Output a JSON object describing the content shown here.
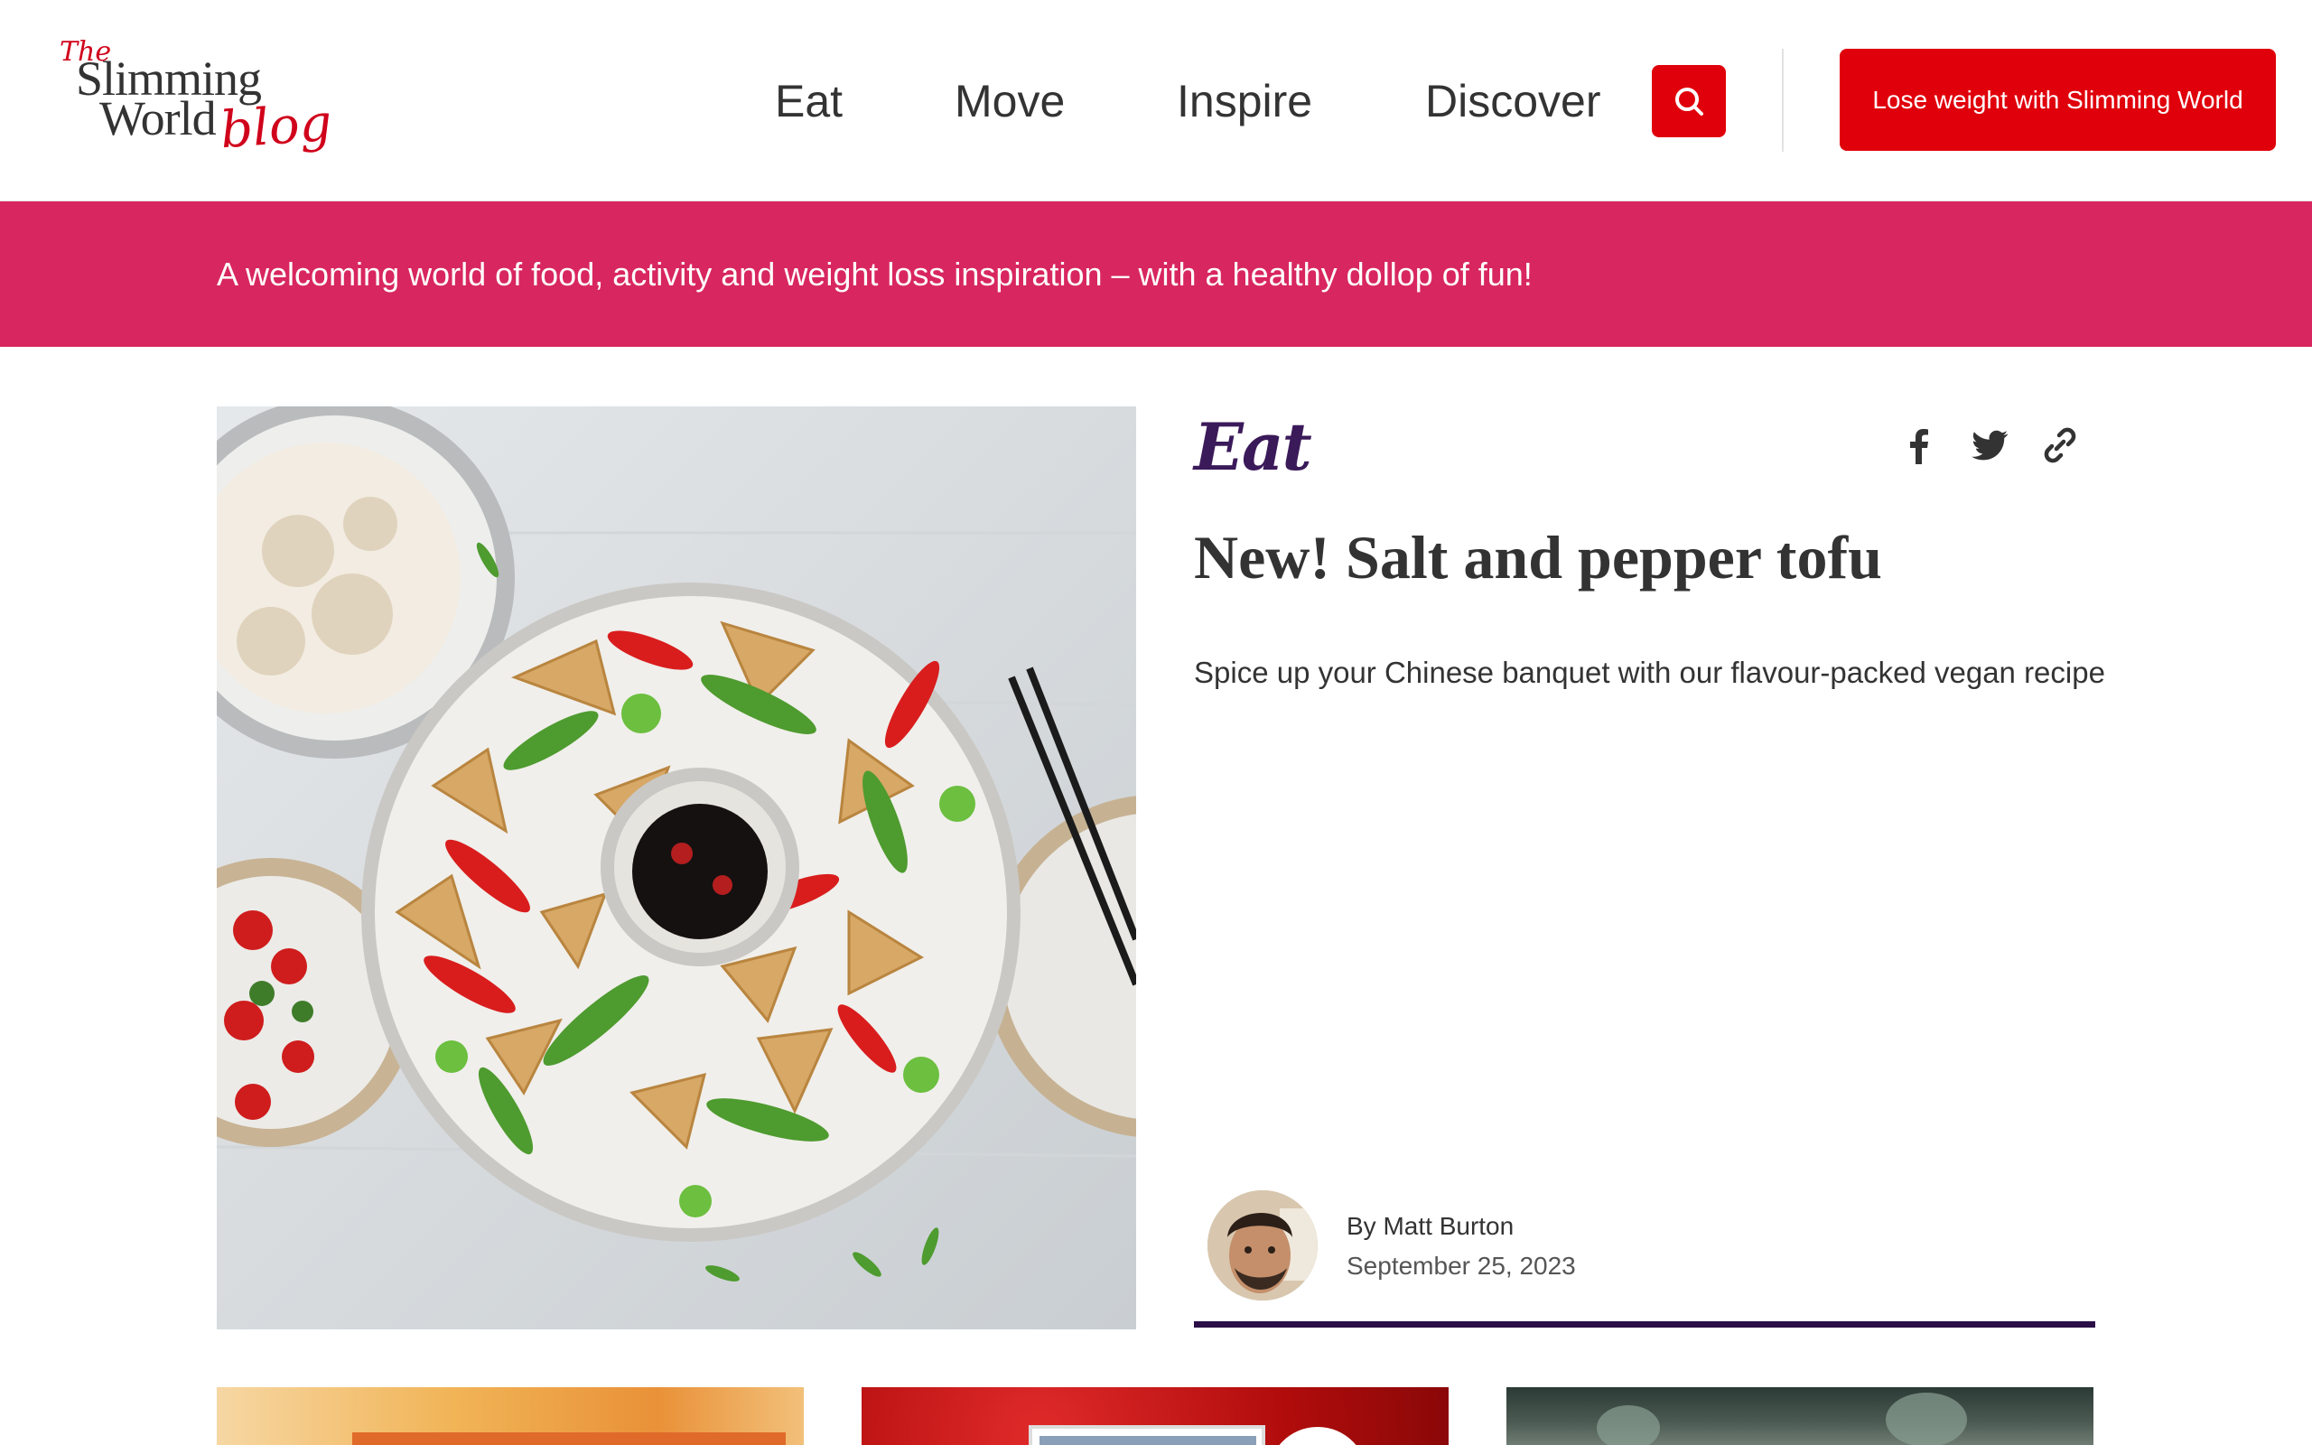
{
  "logo": {
    "the": "The",
    "line1": "Slimming",
    "line2": "World",
    "line3": "blog"
  },
  "nav": {
    "items": [
      {
        "label": "Eat"
      },
      {
        "label": "Move"
      },
      {
        "label": "Inspire"
      },
      {
        "label": "Discover"
      }
    ],
    "search_icon": "search-icon",
    "cta_label": "Lose weight with Slimming World"
  },
  "banner": {
    "text": "A welcoming world of food, activity and weight loss inspiration – with a healthy dollop of fun!"
  },
  "featured": {
    "category": "Eat",
    "title": "New! Salt and pepper tofu",
    "subtitle": "Spice up your Chinese banquet with our flavour-packed vegan recipe",
    "author": "By Matt Burton",
    "date": "September 25, 2023",
    "share_icons": [
      "facebook-icon",
      "twitter-icon",
      "link-icon"
    ]
  },
  "colors": {
    "brand_red": "#e0000b",
    "banner_pink": "#d82660",
    "category_purple": "#3b1a5a",
    "underline_purple": "#2b0f47"
  }
}
